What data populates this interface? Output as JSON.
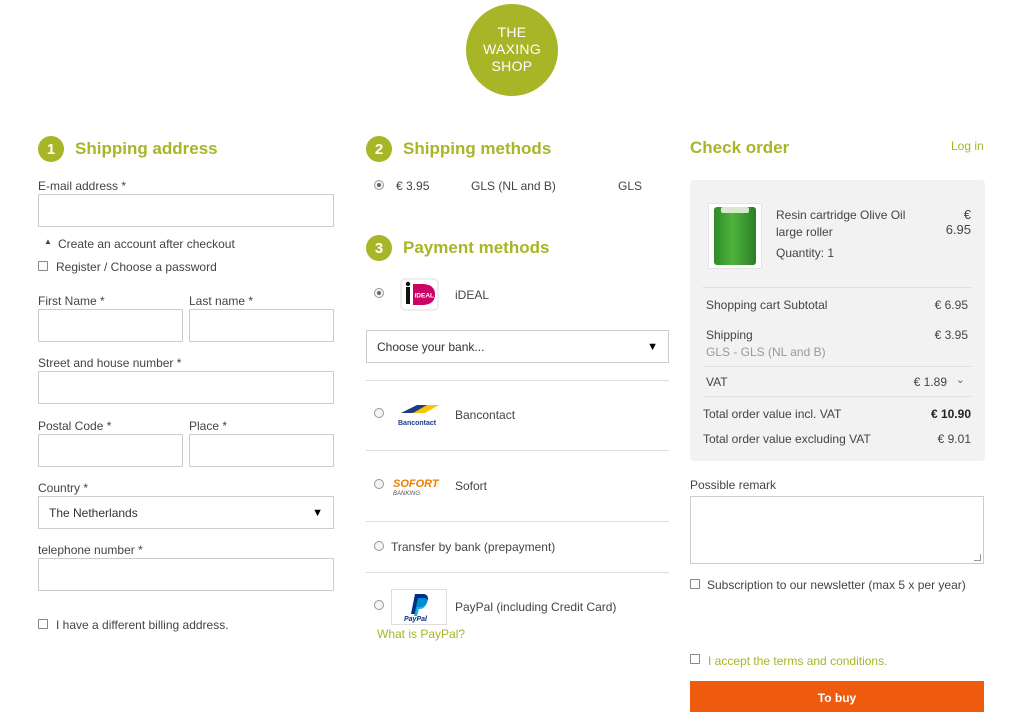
{
  "logo": {
    "line1": "THE",
    "line2": "WAXING",
    "line3": "SHOP"
  },
  "shipping_address": {
    "number": "1",
    "title": "Shipping address",
    "email_label": "E-mail address *",
    "create_account": "Create an account after checkout",
    "register_label": "Register / Choose a password",
    "first_name_label": "First Name *",
    "last_name_label": "Last name *",
    "street_label": "Street and house number *",
    "postal_label": "Postal Code *",
    "place_label": "Place *",
    "country_label": "Country *",
    "country_value": "The Netherlands",
    "phone_label": "telephone number *",
    "billing_label": "I have a different billing address."
  },
  "shipping_methods": {
    "number": "2",
    "title": "Shipping methods",
    "option": {
      "price": "€ 3.95",
      "name": "GLS (NL and B)",
      "carrier": "GLS"
    }
  },
  "payment_methods": {
    "number": "3",
    "title": "Payment methods",
    "ideal_label": "iDEAL",
    "ideal_logo_text": "iDEAL",
    "bank_select": "Choose your bank...",
    "bancontact_label": "Bancontact",
    "bancontact_logo_text": "Bancontact",
    "sofort_label": "Sofort",
    "sofort_logo_text": "SOFORT",
    "sofort_logo_sub": "BANKING",
    "transfer_label": "Transfer by bank (prepayment)",
    "paypal_label": "PayPal (including Credit Card)",
    "paypal_logo_text": "PayPal",
    "paypal_link": "What is PayPal?"
  },
  "check_order": {
    "title": "Check order",
    "login": "Log in",
    "product": {
      "name_line1": "Resin cartridge Olive Oil",
      "name_line2": "large roller",
      "quantity": "Quantity: 1",
      "price_currency": "€",
      "price": "6.95"
    },
    "subtotal_label": "Shopping cart Subtotal",
    "subtotal_value": "€ 6.95",
    "shipping_label": "Shipping",
    "shipping_sub": "GLS - GLS (NL and B)",
    "shipping_value": "€ 3.95",
    "vat_label": "VAT",
    "vat_value": "€ 1.89",
    "total_incl_label": "Total order value incl. VAT",
    "total_incl_value": "€ 10.90",
    "total_excl_label": "Total order value excluding VAT",
    "total_excl_value": "€ 9.01",
    "remark_label": "Possible remark",
    "newsletter_label": "Subscription to our newsletter (max 5 x per year)",
    "terms_label": "I accept the terms and conditions.",
    "buy_label": "To buy"
  },
  "colors": {
    "accent": "#a8b527",
    "buy_button": "#ee5a0e"
  }
}
